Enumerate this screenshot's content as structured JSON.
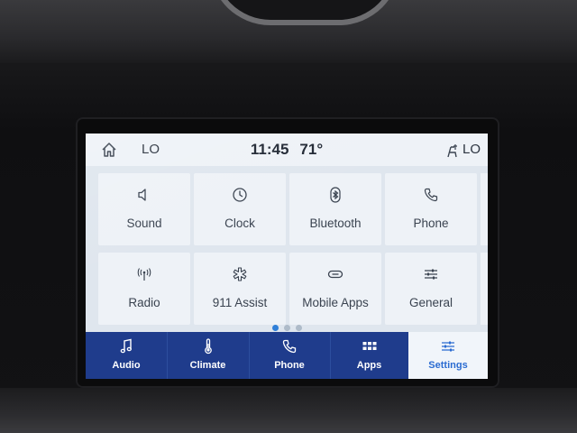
{
  "status_bar": {
    "left_label": "LO",
    "time": "11:45",
    "temperature": "71°",
    "right_label": "LO"
  },
  "tiles": [
    {
      "label": "Sound",
      "icon": "speaker-icon"
    },
    {
      "label": "Clock",
      "icon": "clock-icon"
    },
    {
      "label": "Bluetooth",
      "icon": "bluetooth-icon"
    },
    {
      "label": "Phone",
      "icon": "phone-icon"
    },
    {
      "label": "Radio",
      "icon": "radio-antenna-icon"
    },
    {
      "label": "911 Assist",
      "icon": "emergency-asterisk-icon"
    },
    {
      "label": "Mobile Apps",
      "icon": "link-icon"
    },
    {
      "label": "General",
      "icon": "sliders-icon"
    }
  ],
  "pager": {
    "pages": 3,
    "active_page": 1
  },
  "nav": [
    {
      "label": "Audio",
      "icon": "music-note-icon",
      "active": false
    },
    {
      "label": "Climate",
      "icon": "thermometer-icon",
      "active": false
    },
    {
      "label": "Phone",
      "icon": "phone-icon",
      "active": false
    },
    {
      "label": "Apps",
      "icon": "apps-grid-icon",
      "active": false
    },
    {
      "label": "Settings",
      "icon": "sliders-icon",
      "active": true
    }
  ],
  "colors": {
    "nav_background": "#1f3c8c",
    "active_accent": "#2a6bd1",
    "tile_background": "#eef2f7",
    "screen_background": "#dfe6ee"
  }
}
